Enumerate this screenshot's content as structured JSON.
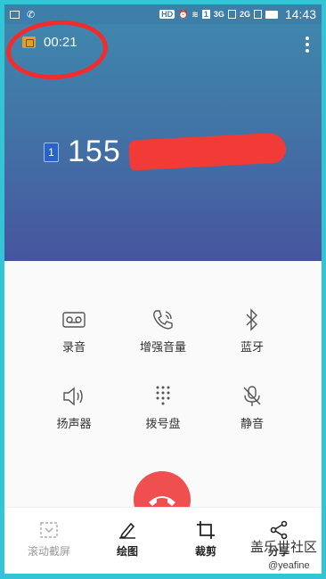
{
  "status_bar": {
    "hd": "HD",
    "network": "3G",
    "network2": "2G",
    "sim": "1",
    "time": "14:43"
  },
  "call": {
    "timer": "00:21",
    "sim_label": "1",
    "number": "155"
  },
  "controls": [
    {
      "label": "录音",
      "icon": "record-icon"
    },
    {
      "label": "增强音量",
      "icon": "enhance-volume-icon"
    },
    {
      "label": "蓝牙",
      "icon": "bluetooth-icon"
    },
    {
      "label": "扬声器",
      "icon": "speaker-icon"
    },
    {
      "label": "拨号盘",
      "icon": "keypad-icon"
    },
    {
      "label": "静音",
      "icon": "mute-icon"
    }
  ],
  "toolbar": [
    {
      "label": "滚动截屏",
      "icon": "scroll-capture-icon"
    },
    {
      "label": "绘图",
      "icon": "draw-icon"
    },
    {
      "label": "裁剪",
      "icon": "crop-icon"
    },
    {
      "label": "分享",
      "icon": "share-icon"
    }
  ],
  "watermark": {
    "title": "盖乐世社区",
    "handle": "@yeafine"
  },
  "colors": {
    "end_call": "#ef4f4f",
    "highlight": "#f22c2c",
    "frame": "#33c5d6"
  }
}
